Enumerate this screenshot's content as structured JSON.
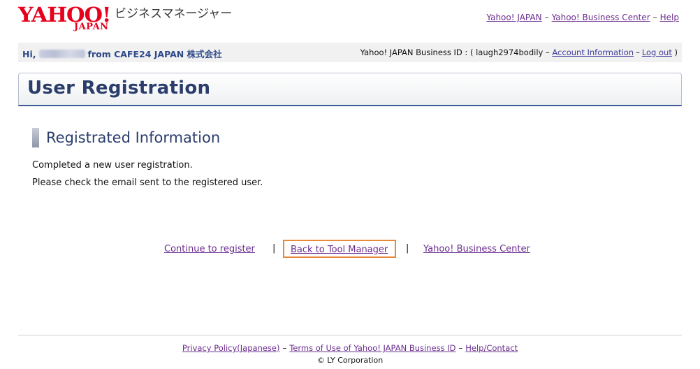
{
  "header": {
    "logo_main": "YAHOO!",
    "logo_sub": "JAPAN",
    "logo_tag": "ビジネスマネージャー",
    "links": [
      {
        "label": "Yahoo! JAPAN"
      },
      {
        "label": "Yahoo! Business Center"
      },
      {
        "label": "Help"
      }
    ],
    "separator": "–"
  },
  "user_bar": {
    "greeting": "Hi,",
    "from_company": "from CAFE24 JAPAN 株式会社",
    "business_id_text": "Yahoo! JAPAN Business ID : ( laugh2974bodily –",
    "account_info": "Account Information",
    "separator": "–",
    "logout": "Log out",
    "close_paren": ")"
  },
  "page": {
    "title": "User Registration",
    "section_title": "Registrated Information",
    "message_line1": "Completed a new user registration.",
    "message_line2": "Please check the email sent to the registered user."
  },
  "actions": {
    "continue": "Continue to register",
    "back": "Back to Tool Manager",
    "business_center": "Yahoo! Business Center",
    "pipe": "|"
  },
  "footer": {
    "privacy": "Privacy Policy(Japanese)",
    "terms": "Terms of Use of Yahoo! JAPAN Business ID",
    "help": "Help/Contact",
    "separator": "–",
    "copyright": "© LY Corporation"
  },
  "colors": {
    "brand_red": "#e6001c",
    "link": "#3d3b98",
    "visited": "#6b2d8e",
    "title_text": "#2b3e6b",
    "highlight_border": "#e8893a"
  }
}
